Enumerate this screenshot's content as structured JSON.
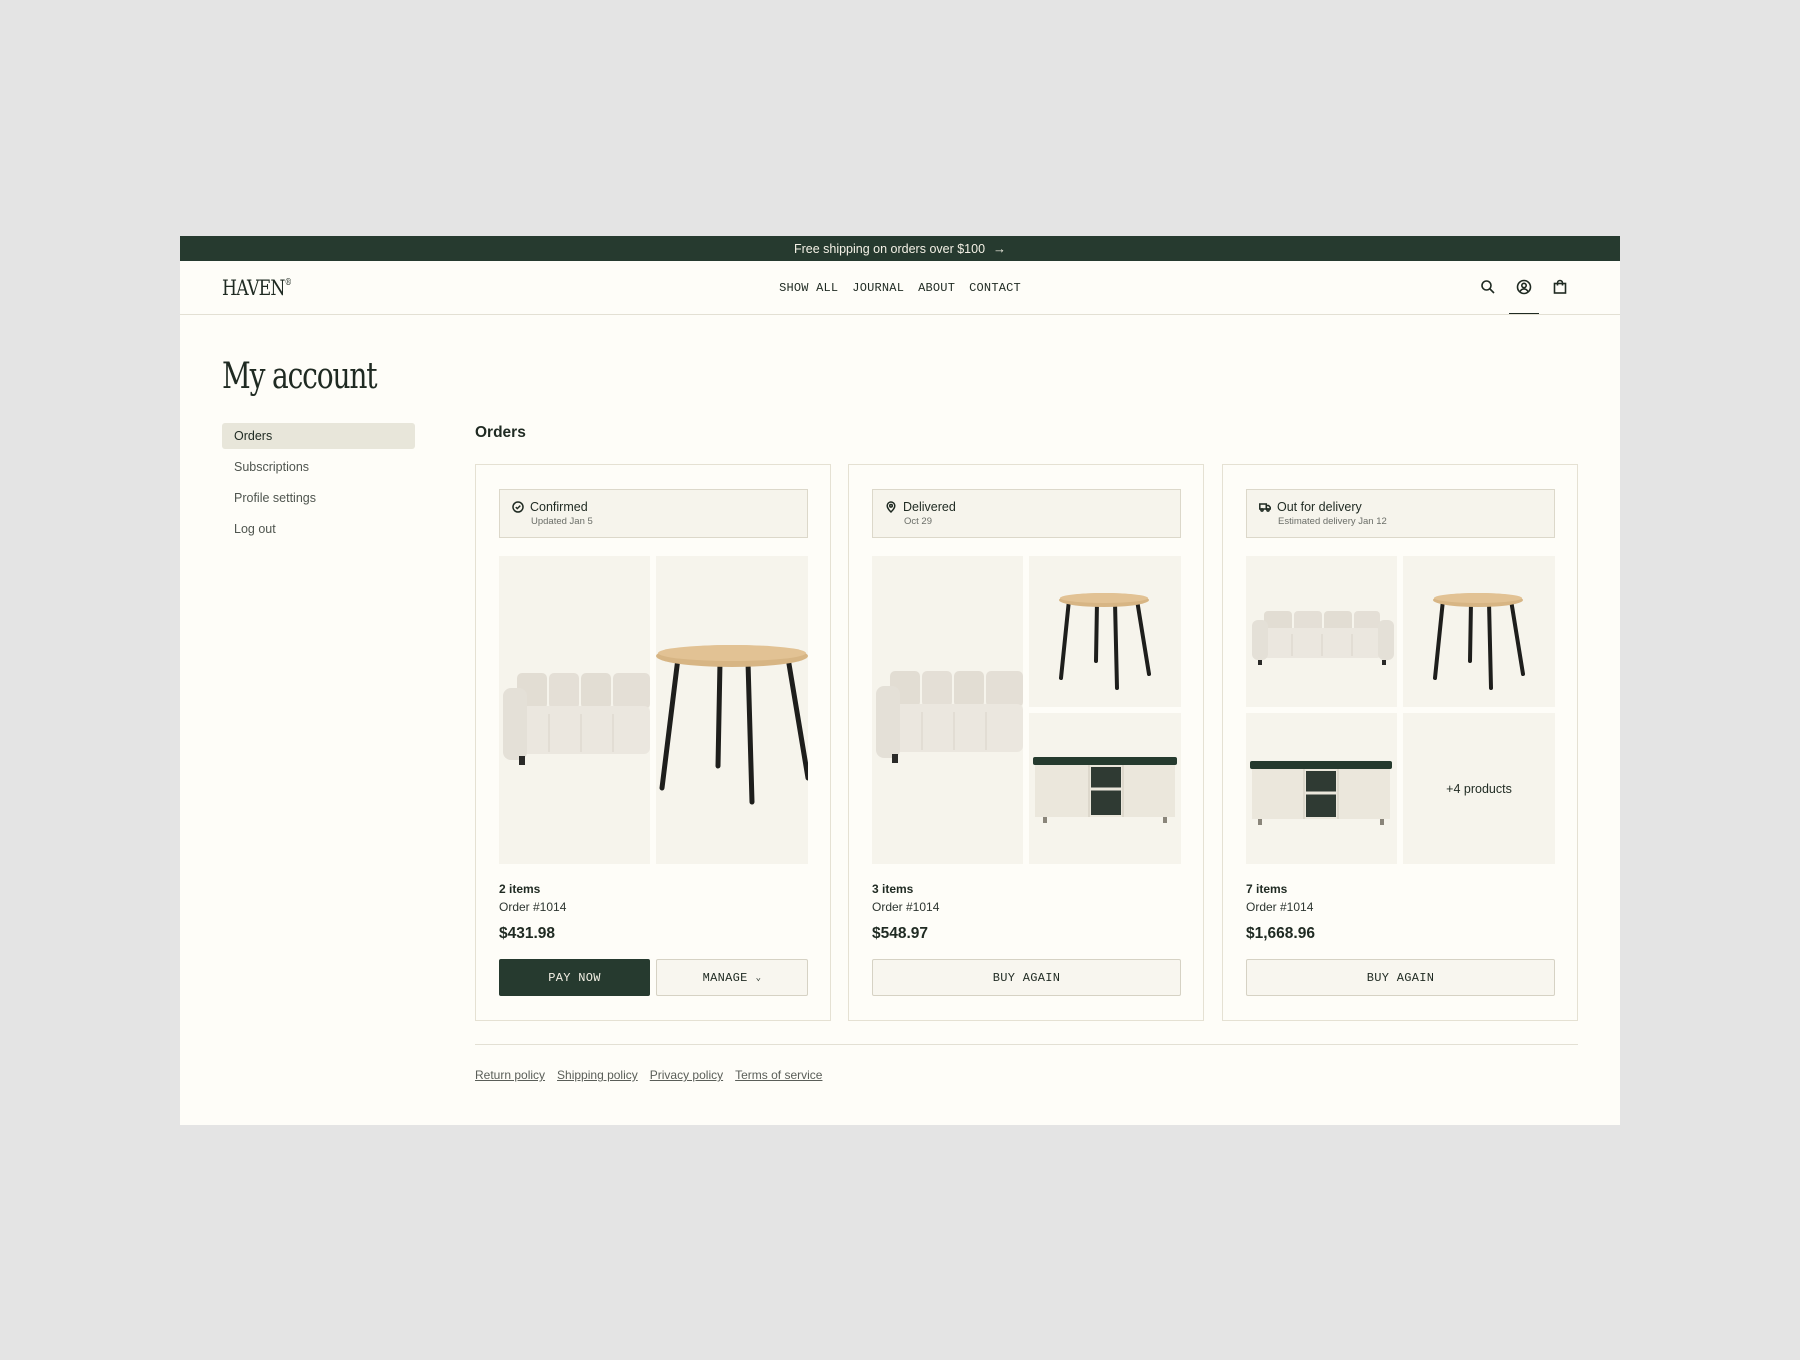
{
  "announcement": {
    "text": "Free shipping on orders over $100",
    "icon": "arrow-right-icon"
  },
  "header": {
    "logo": "HAVEN",
    "logo_mark": "®",
    "nav": [
      "SHOW ALL",
      "JOURNAL",
      "ABOUT",
      "CONTACT"
    ],
    "icons": [
      "search-icon",
      "account-icon",
      "bag-icon"
    ],
    "active_icon": "account-icon"
  },
  "page": {
    "title": "My account",
    "section_title": "Orders"
  },
  "sidebar": {
    "items": [
      {
        "label": "Orders",
        "active": true
      },
      {
        "label": "Subscriptions",
        "active": false
      },
      {
        "label": "Profile settings",
        "active": false
      },
      {
        "label": "Log out",
        "active": false
      }
    ]
  },
  "orders": [
    {
      "status": "Confirmed",
      "status_sub": "Updated Jan 5",
      "status_icon": "check-circle-icon",
      "products": [
        "sofa",
        "round-table"
      ],
      "items": "2 items",
      "order": "Order #1014",
      "price": "$431.98",
      "buttons": [
        "PAY NOW",
        "MANAGE"
      ]
    },
    {
      "status": "Delivered",
      "status_sub": "Oct 29",
      "status_icon": "location-pin-icon",
      "products": [
        "sofa",
        "round-table",
        "tv-cabinet"
      ],
      "items": "3 items",
      "order": "Order #1014",
      "price": "$548.97",
      "buttons": [
        "BUY AGAIN"
      ]
    },
    {
      "status": "Out for delivery",
      "status_sub": "Estimated delivery Jan 12",
      "status_icon": "truck-icon",
      "products": [
        "sofa",
        "round-table",
        "tv-cabinet"
      ],
      "more_products": "+4 products",
      "items": "7 items",
      "order": "Order #1014",
      "price": "$1,668.96",
      "buttons": [
        "BUY AGAIN"
      ]
    }
  ],
  "footer": {
    "links": [
      "Return policy",
      "Shipping policy",
      "Privacy policy",
      "Terms of service"
    ]
  },
  "colors": {
    "brand": "#263a2f",
    "background": "#fefdf8",
    "tile": "#f6f4ec",
    "outer": "#e4e4e4"
  }
}
